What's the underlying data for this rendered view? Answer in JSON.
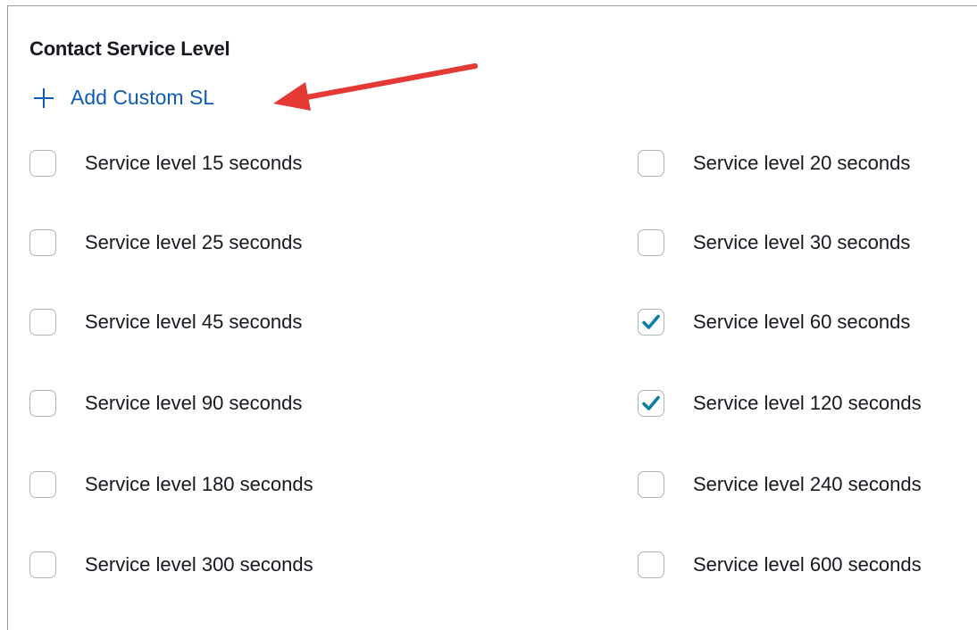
{
  "section": {
    "title": "Contact Service Level",
    "add_custom_label": "Add Custom SL"
  },
  "options": [
    {
      "label": "Service level 15 seconds",
      "checked": false
    },
    {
      "label": "Service level 20 seconds",
      "checked": false
    },
    {
      "label": "Service level 25 seconds",
      "checked": false
    },
    {
      "label": "Service level 30 seconds",
      "checked": false
    },
    {
      "label": "Service level 45 seconds",
      "checked": false
    },
    {
      "label": "Service level 60 seconds",
      "checked": true
    },
    {
      "label": "Service level 90 seconds",
      "checked": false
    },
    {
      "label": "Service level 120 seconds",
      "checked": true
    },
    {
      "label": "Service level 180 seconds",
      "checked": false
    },
    {
      "label": "Service level 240 seconds",
      "checked": false
    },
    {
      "label": "Service level 300 seconds",
      "checked": false
    },
    {
      "label": "Service level 600 seconds",
      "checked": false
    }
  ],
  "colors": {
    "link": "#0f5bb5",
    "check": "#0a7ea3",
    "annotation_arrow": "#e53935"
  }
}
